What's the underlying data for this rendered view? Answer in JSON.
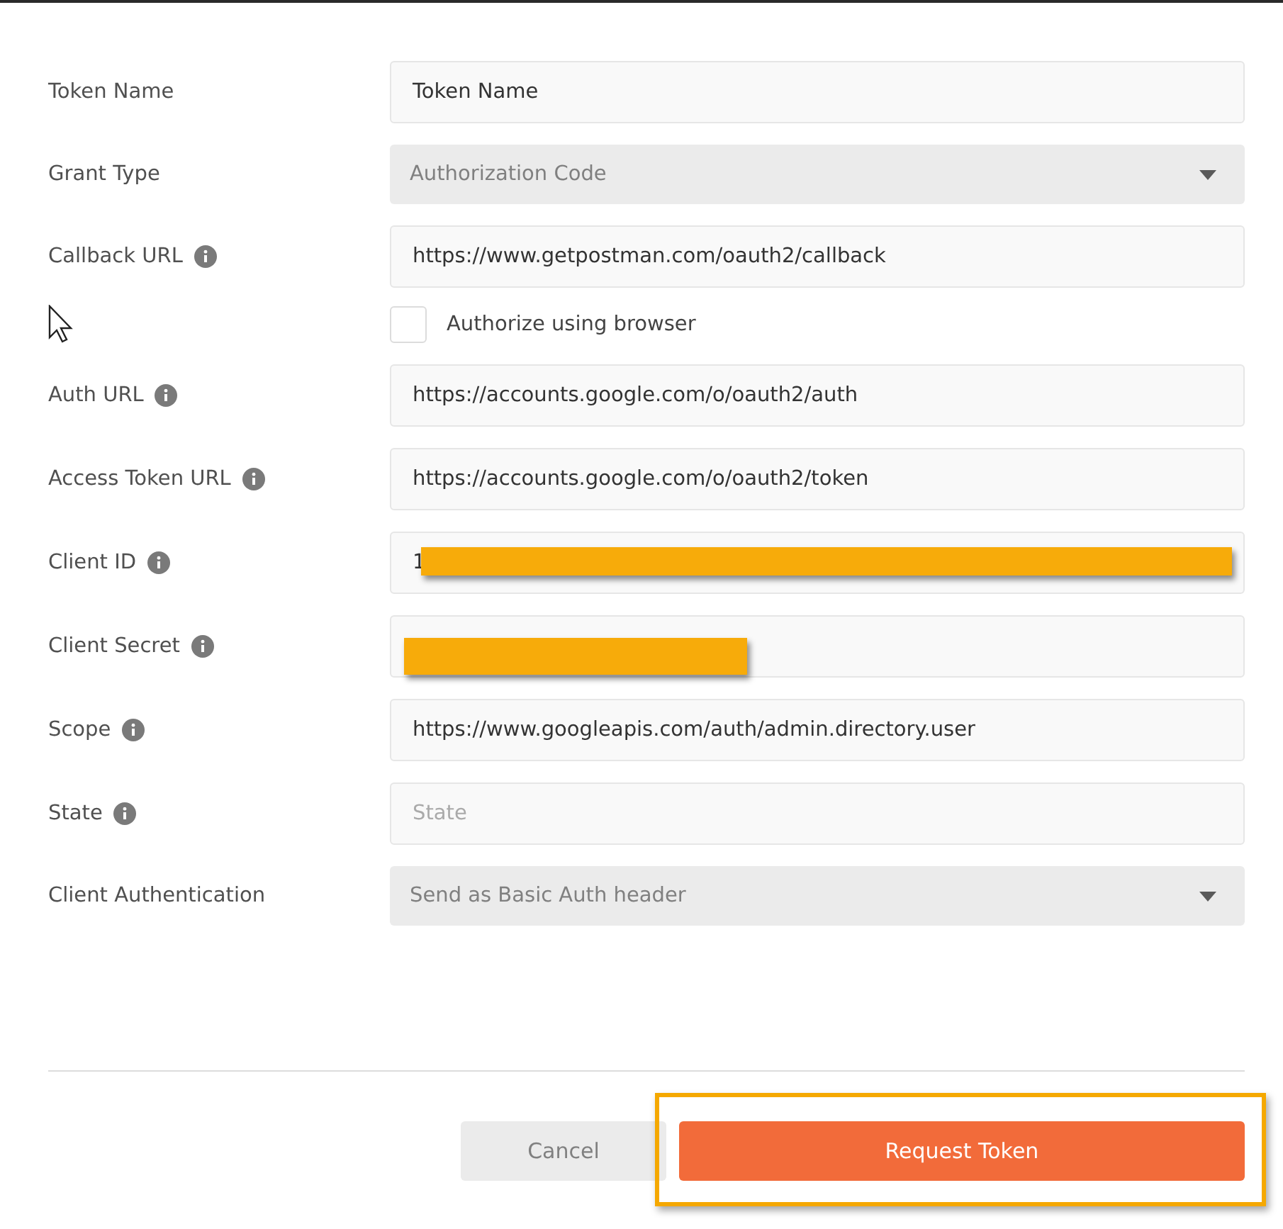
{
  "fields": [
    {
      "kind": "text",
      "label": "Token Name",
      "info": false,
      "value": "Token Name",
      "redacted": false
    },
    {
      "kind": "select",
      "label": "Grant Type",
      "info": false,
      "value": "Authorization Code"
    },
    {
      "kind": "text",
      "label": "Callback URL",
      "info": true,
      "value": "https://www.getpostman.com/oauth2/callback",
      "redacted": false
    },
    {
      "kind": "checkbox",
      "label": "Authorize using browser",
      "checked": false
    },
    {
      "kind": "text",
      "label": "Auth URL",
      "info": true,
      "value": "https://accounts.google.com/o/oauth2/auth",
      "redacted": false
    },
    {
      "kind": "text",
      "label": "Access Token URL",
      "info": true,
      "value": "https://accounts.google.com/o/oauth2/token",
      "redacted": false
    },
    {
      "kind": "text",
      "label": "Client ID",
      "info": true,
      "value": "1",
      "redacted": true
    },
    {
      "kind": "text",
      "label": "Client Secret",
      "info": true,
      "redacted": true
    },
    {
      "kind": "text",
      "label": "Scope",
      "info": true,
      "value": "https://www.googleapis.com/auth/admin.directory.user",
      "redacted": false
    },
    {
      "kind": "text",
      "label": "State",
      "info": true,
      "placeholder": "State",
      "redacted": false
    },
    {
      "kind": "select",
      "label": "Client Authentication",
      "info": false,
      "value": "Send as Basic Auth header"
    }
  ],
  "buttons": [
    {
      "kind": "secondary",
      "label": "Cancel",
      "highlighted": false
    },
    {
      "kind": "primary",
      "label": "Request Token",
      "highlighted": true
    }
  ]
}
